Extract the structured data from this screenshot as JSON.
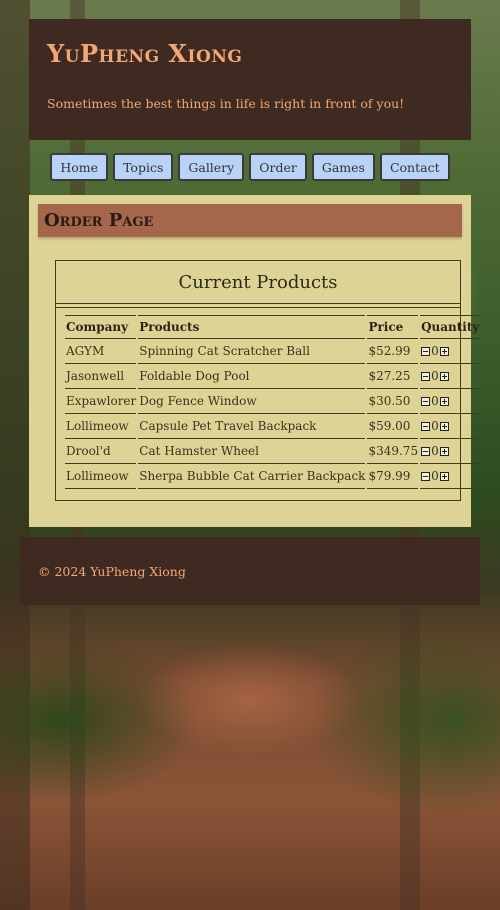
{
  "header": {
    "title": "YuPheng Xiong",
    "tagline": "Sometimes the best things in life is right in front of you!"
  },
  "nav": {
    "items": [
      "Home",
      "Topics",
      "Gallery",
      "Order",
      "Games",
      "Contact"
    ]
  },
  "main": {
    "heading": "Order Page",
    "products_title": "Current Products",
    "columns": [
      "Company",
      "Products",
      "Price",
      "Quantity"
    ],
    "rows": [
      {
        "company": "AGYM",
        "product": "Spinning Cat Scratcher Ball",
        "price": "$52.99",
        "qty": "0"
      },
      {
        "company": "Jasonwell",
        "product": "Foldable Dog Pool",
        "price": "$27.25",
        "qty": "0"
      },
      {
        "company": "Expawlorer",
        "product": "Dog Fence Window",
        "price": "$30.50",
        "qty": "0"
      },
      {
        "company": "Lollimeow",
        "product": "Capsule Pet Travel Backpack",
        "price": "$59.00",
        "qty": "0"
      },
      {
        "company": "Drool'd",
        "product": "Cat Hamster Wheel",
        "price": "$349.75",
        "qty": "0"
      },
      {
        "company": "Lollimeow",
        "product": "Sherpa Bubble Cat Carrier Backpack",
        "price": "$79.99",
        "qty": "0"
      }
    ]
  },
  "footer": {
    "copyright": "© 2024 YuPheng Xiong"
  },
  "colors": {
    "header_bg": "#3f2a21",
    "accent_text": "#f2a874",
    "main_bg": "#ddd395",
    "heading_bg": "#a5674b",
    "nav_button_bg": "#b8d3f7"
  },
  "icons": {
    "decrement": "minus-square-icon",
    "increment": "plus-square-icon"
  }
}
